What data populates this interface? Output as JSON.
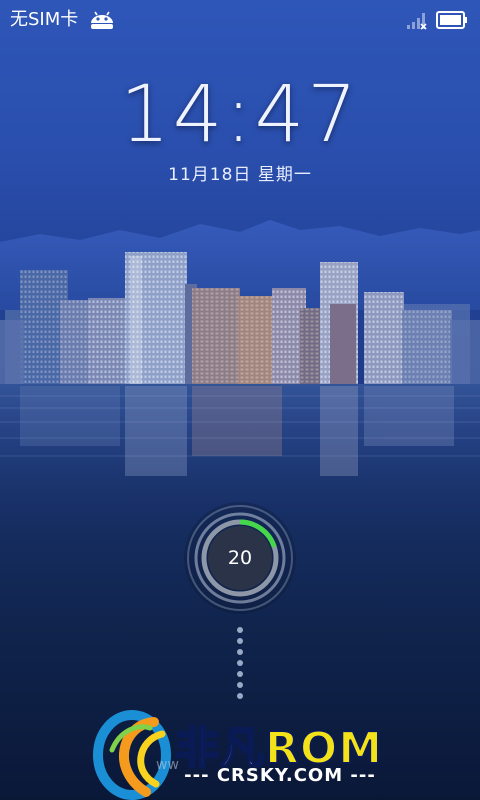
{
  "status_bar": {
    "carrier": "无SIM卡",
    "notification_icon": "android-icon",
    "signal_icon": "signal-icon",
    "battery_icon": "battery-icon"
  },
  "lockscreen": {
    "time": "14:47",
    "date": "11月18日  星期一",
    "unlock_ring": {
      "value": "20",
      "progress_fraction": 0.2,
      "accent_color": "#46d64a"
    }
  },
  "watermark": {
    "logo_text_cn": "非凡",
    "logo_text_en": "ROM",
    "url": "--- CRSKY.COM ---",
    "partial_text": "ww"
  },
  "colors": {
    "sky_top": "#2e56b8",
    "sky_bottom": "#0a1838",
    "progress_green": "#46d64a",
    "watermark_yellow": "#f3e21a"
  }
}
